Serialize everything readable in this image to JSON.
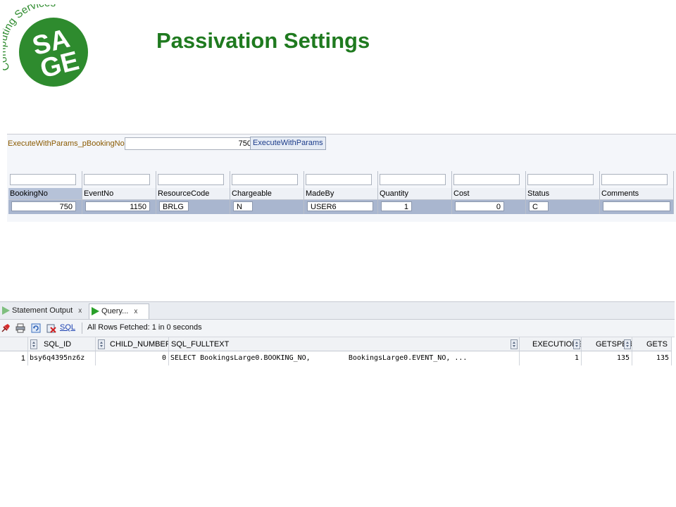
{
  "logo": {
    "arc_text": "Computing Services",
    "lines": [
      "SA",
      "GE"
    ],
    "color": "#2e8b2e"
  },
  "slide": {
    "title": "Passivation Settings"
  },
  "form": {
    "param_label": "ExecuteWithParams_pBookingNo",
    "param_value": "750",
    "exec_button": "ExecuteWithParams",
    "columns": [
      "BookingNo",
      "EventNo",
      "ResourceCode",
      "Chargeable",
      "MadeBy",
      "Quantity",
      "Cost",
      "Status",
      "Comments"
    ],
    "row": [
      "750",
      "1150",
      "BRLG",
      "N",
      "USER6",
      "1",
      "0",
      "C",
      ""
    ]
  },
  "console": {
    "tabs": [
      {
        "label": "Statement Output",
        "close": "x"
      },
      {
        "label": "Query...",
        "close": "x"
      }
    ],
    "toolbar": {
      "icons": [
        "pin-icon",
        "print-icon",
        "refresh-icon",
        "clear-icon"
      ],
      "sql_link": "SQL",
      "status": "All Rows Fetched: 1 in 0 seconds"
    },
    "result": {
      "columns": [
        "SQL_ID",
        "CHILD_NUMBER",
        "SQL_FULLTEXT",
        "EXECUTIONS",
        "GETSPER",
        "GETS"
      ],
      "rows": [
        {
          "num": "1",
          "cells": [
            "bsy6q4395nz6z",
            "0",
            "SELECT BookingsLarge0.BOOKING_NO,         BookingsLarge0.EVENT_NO, ...",
            "1",
            "135",
            "135"
          ]
        }
      ]
    }
  }
}
